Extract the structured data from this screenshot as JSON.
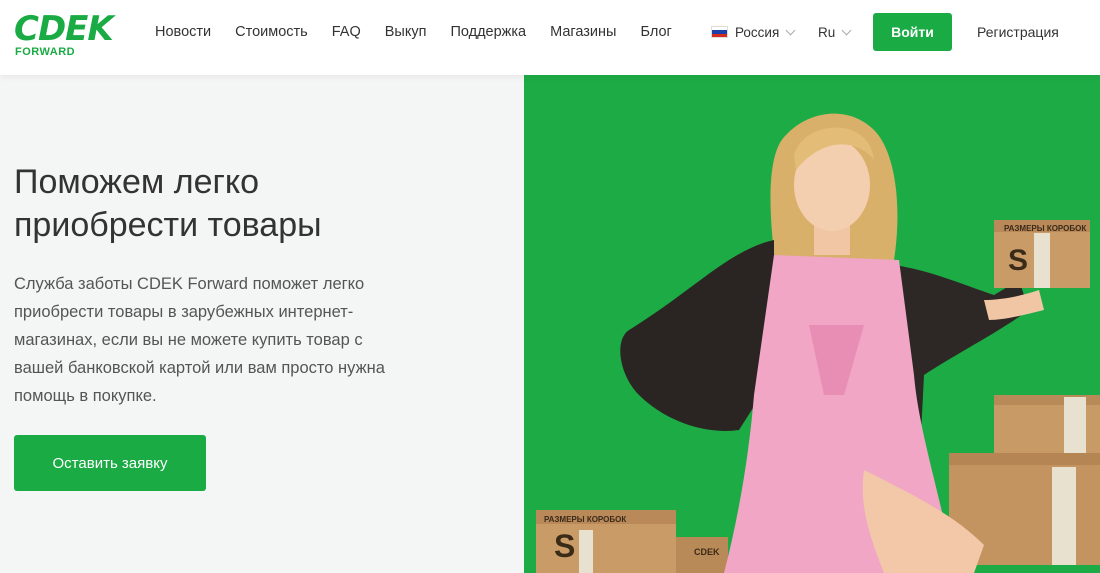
{
  "header": {
    "logo_main": "CDEK",
    "logo_sub": "FORWARD",
    "nav": [
      "Новости",
      "Стоимость",
      "FAQ",
      "Выкуп",
      "Поддержка",
      "Магазины",
      "Блог"
    ],
    "country": "Россия",
    "language": "Ru",
    "login_label": "Войти",
    "register_label": "Регистрация"
  },
  "hero": {
    "title": "Поможем легко приобрести товары",
    "text": "Служба заботы CDEK Forward поможет легко приобрести товары в зарубежных интернет-магазинах, если вы не можете купить товар с вашей банковской картой или вам просто нужна помощь в покупке.",
    "cta_label": "Оставить заявку"
  },
  "illustration": {
    "box_label_1": "РАЗМЕРЫ КОРОБОК",
    "box_label_2": "РАЗМЕРЫ КОРОБОК",
    "box_letter": "S",
    "box_brand": "CDEK"
  },
  "colors": {
    "brand": "#1aab44",
    "panel_bg": "#f4f5f5",
    "hero_bg": "#1dab45"
  }
}
